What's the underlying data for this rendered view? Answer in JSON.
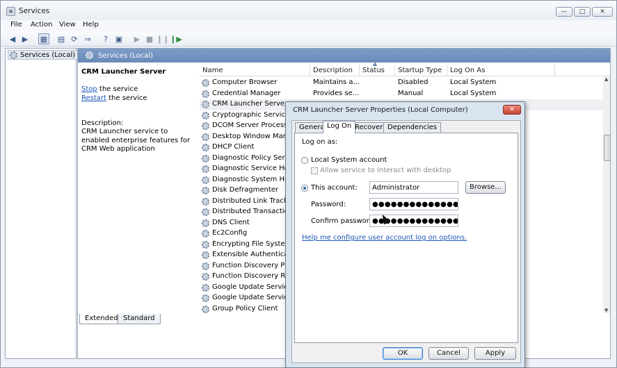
{
  "window": {
    "title": "Services"
  },
  "menu": [
    "File",
    "Action",
    "View",
    "Help"
  ],
  "tree": {
    "selected_label": "Services (Local)"
  },
  "pane": {
    "header": "Services (Local)"
  },
  "service_info": {
    "name": "CRM Launcher Server",
    "stop_link": "Stop",
    "stop_suffix": " the service",
    "restart_link": "Restart",
    "restart_suffix": " the service",
    "description_label": "Description:",
    "description": "CRM Launcher service to enabled enterprise features for CRM Web application"
  },
  "columns": {
    "name": "Name",
    "description": "Description",
    "status": "Status",
    "startup": "Startup Type",
    "logon": "Log On As"
  },
  "services": [
    {
      "name": "Computer Browser",
      "description": "Maintains a...",
      "status": "",
      "startup": "Disabled",
      "logon": "Local System"
    },
    {
      "name": "Credential Manager",
      "description": "Provides se...",
      "status": "",
      "startup": "Manual",
      "logon": "Local System"
    },
    {
      "name": "CRM Launcher Server",
      "description": "",
      "status": "",
      "startup": "",
      "logon": ""
    },
    {
      "name": "Cryptographic Services",
      "description": "",
      "status": "",
      "startup": "",
      "logon": ""
    },
    {
      "name": "DCOM Server Process La",
      "description": "",
      "status": "",
      "startup": "",
      "logon": ""
    },
    {
      "name": "Desktop Window Manag",
      "description": "",
      "status": "",
      "startup": "",
      "logon": ""
    },
    {
      "name": "DHCP Client",
      "description": "",
      "status": "",
      "startup": "",
      "logon": ""
    },
    {
      "name": "Diagnostic Policy Service",
      "description": "",
      "status": "",
      "startup": "",
      "logon": ""
    },
    {
      "name": "Diagnostic Service Host",
      "description": "",
      "status": "",
      "startup": "",
      "logon": ""
    },
    {
      "name": "Diagnostic System Host",
      "description": "",
      "status": "",
      "startup": "",
      "logon": ""
    },
    {
      "name": "Disk Defragmenter",
      "description": "",
      "status": "",
      "startup": "",
      "logon": ""
    },
    {
      "name": "Distributed Link Tracking",
      "description": "",
      "status": "",
      "startup": "",
      "logon": ""
    },
    {
      "name": "Distributed Transaction C",
      "description": "",
      "status": "",
      "startup": "",
      "logon": ""
    },
    {
      "name": "DNS Client",
      "description": "",
      "status": "",
      "startup": "",
      "logon": ""
    },
    {
      "name": "Ec2Config",
      "description": "",
      "status": "",
      "startup": "",
      "logon": ""
    },
    {
      "name": "Encrypting File System (E",
      "description": "",
      "status": "",
      "startup": "",
      "logon": ""
    },
    {
      "name": "Extensible Authentication",
      "description": "",
      "status": "",
      "startup": "",
      "logon": ""
    },
    {
      "name": "Function Discovery Provi",
      "description": "",
      "status": "",
      "startup": "",
      "logon": ""
    },
    {
      "name": "Function Discovery Reso",
      "description": "",
      "status": "",
      "startup": "",
      "logon": ""
    },
    {
      "name": "Google Update Service (g",
      "description": "",
      "status": "",
      "startup": "",
      "logon": ""
    },
    {
      "name": "Google Update Service (g",
      "description": "",
      "status": "",
      "startup": "",
      "logon": ""
    },
    {
      "name": "Group Policy Client",
      "description": "",
      "status": "",
      "startup": "",
      "logon": ""
    }
  ],
  "bottom_tabs": [
    "Extended",
    "Standard"
  ],
  "dialog": {
    "title": "CRM Launcher Server Properties (Local Computer)",
    "tabs": [
      "General",
      "Log On",
      "Recovery",
      "Dependencies"
    ],
    "active_tab": "Log On",
    "logon_as_label": "Log on as:",
    "local_system_label": "Local System account",
    "allow_interact_label": "Allow service to interact with desktop",
    "this_account_label": "This account:",
    "account_value": "Administrator",
    "browse_label": "Browse...",
    "password_label": "Password:",
    "password_value": "●●●●●●●●●●●●●●●",
    "confirm_label": "Confirm password:",
    "confirm_value": "●●●●●●●●●●●●●●●",
    "help_link": "Help me configure user account log on options.",
    "ok_label": "OK",
    "cancel_label": "Cancel",
    "apply_label": "Apply"
  }
}
